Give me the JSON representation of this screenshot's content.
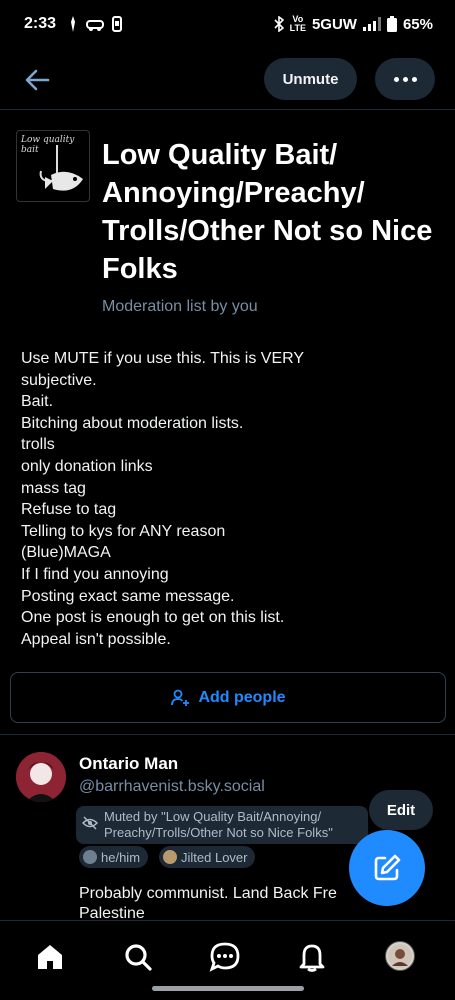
{
  "status_bar": {
    "time": "2:33",
    "network_top": "Vo",
    "network_bottom": "LTE",
    "signal_label": "5GUW",
    "battery": "65%"
  },
  "top_bar": {
    "unmute_label": "Unmute"
  },
  "list": {
    "title": "Low Quality Bait/ Annoying/Preachy/ Trolls/Other Not so Nice Folks",
    "subtitle": "Moderation list by you",
    "avatar_text_1": "Low quality",
    "avatar_text_2": "bait",
    "description_lines": [
      "Use MUTE if you use this. This is VERY",
      "subjective.",
      "Bait.",
      "Bitching about moderation lists.",
      "trolls",
      "only donation links",
      "mass tag",
      "Refuse to tag",
      "Telling to kys for ANY reason",
      "(Blue)MAGA",
      "If I find you annoying",
      "Posting exact same message.",
      "One post is enough to get on this list.",
      "Appeal isn't possible."
    ],
    "add_people_label": "Add people"
  },
  "member": {
    "name": "Ontario Man",
    "handle": "@barrhavenist.bsky.social",
    "muted_line_1": "Muted by \"Low Quality Bait/Annoying/",
    "muted_line_2": "Preachy/Trolls/Other Not so Nice Folks\"",
    "edit_label": "Edit",
    "pronouns": "he/him",
    "tag": "Jilted Lover",
    "bio_line_1": "Probably communist. Land Back Fre",
    "bio_line_2": "Palestine"
  },
  "colors": {
    "background": "#000000",
    "accent": "#208bfe",
    "surface": "#1e2936",
    "muted_text": "#788ea5"
  },
  "icons": {
    "back": "arrow-left-icon",
    "more": "ellipsis-icon",
    "add_people": "user-plus-icon",
    "muted": "eye-slash-icon",
    "compose": "pencil-square-icon",
    "home": "home-icon",
    "search": "search-icon",
    "chat": "chat-bubble-icon",
    "notifications": "bell-icon"
  }
}
